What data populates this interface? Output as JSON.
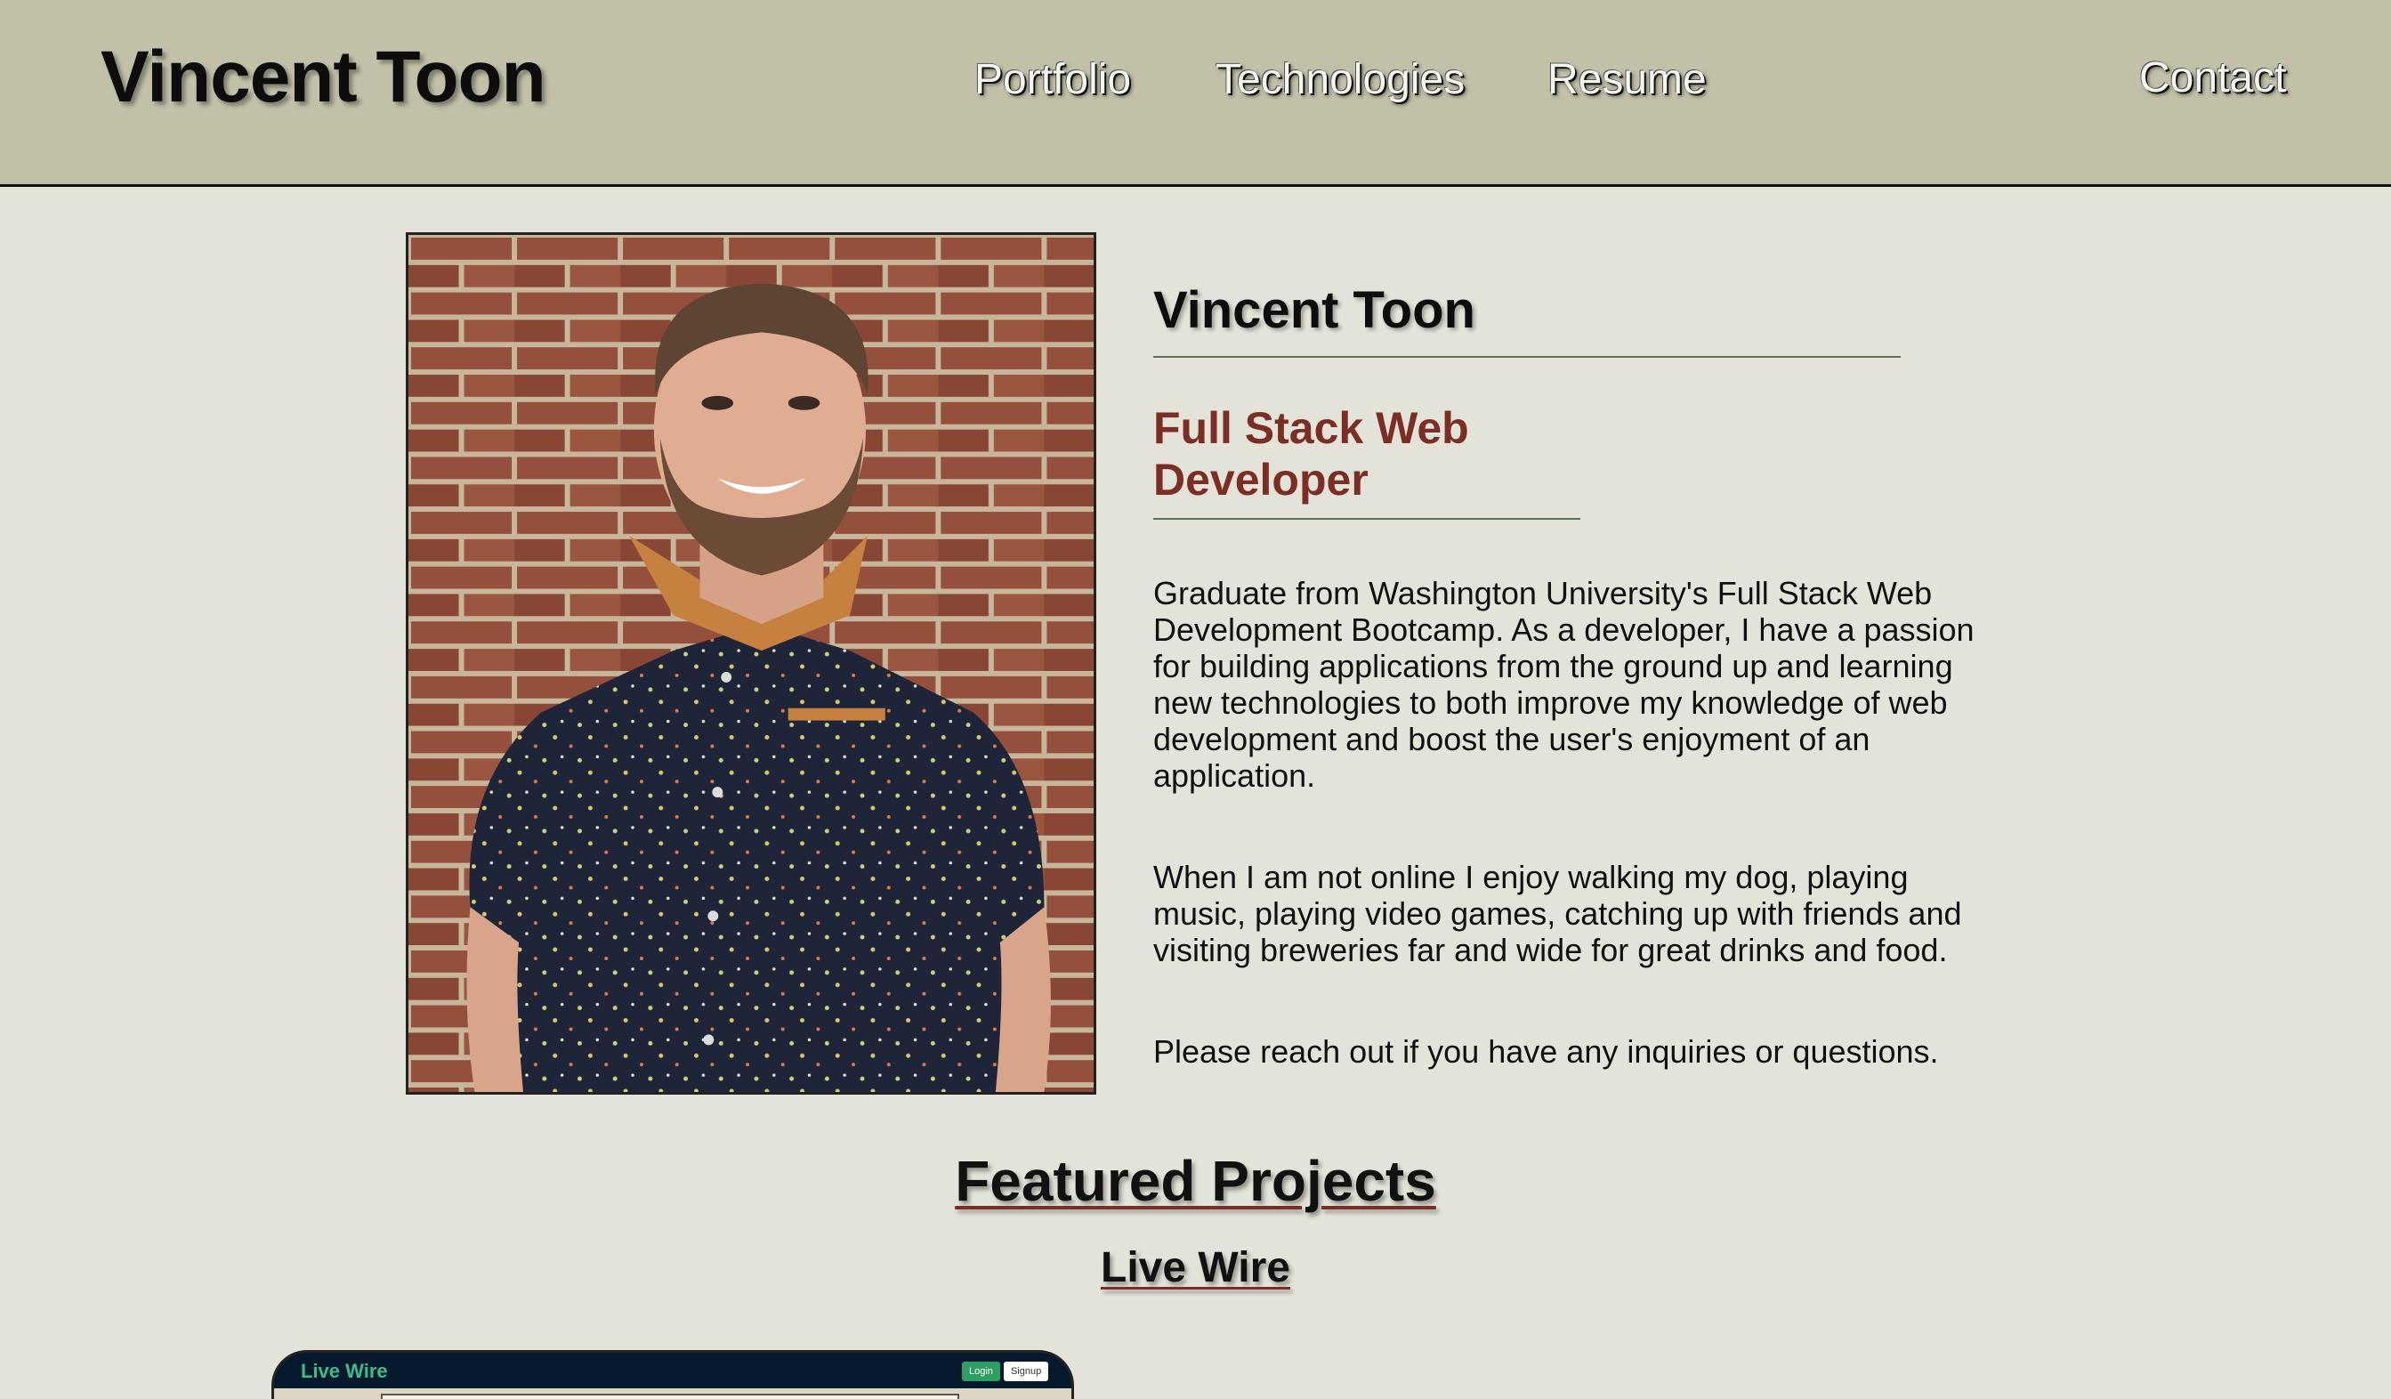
{
  "header": {
    "brand": "Vincent Toon",
    "nav": [
      "Portfolio",
      "Technologies",
      "Resume",
      "Contact"
    ]
  },
  "bio": {
    "name": "Vincent Toon",
    "role": "Full Stack Web Developer",
    "paragraphs": [
      "Graduate from Washington University's Full Stack Web Development Bootcamp. As a developer, I have a passion for building applications from the ground up and learning new technologies to both improve my knowledge of web development and boost the user's enjoyment of an application.",
      "When I am not online I enjoy walking my dog, playing music, playing video games, catching up with friends and visiting breweries far and wide for great drinks and food.",
      "Please reach out if you have any inquiries or questions."
    ]
  },
  "featured": {
    "heading": "Featured Projects",
    "project_title": "Live Wire",
    "thumbnail": {
      "app_title": "Live Wire",
      "login_label": "Login",
      "signup_label": "Signup"
    }
  },
  "colors": {
    "header_bg": "#c2c0a9",
    "page_bg": "#e4e3da",
    "accent": "#7a2e24",
    "rule": "#5b6e52"
  }
}
